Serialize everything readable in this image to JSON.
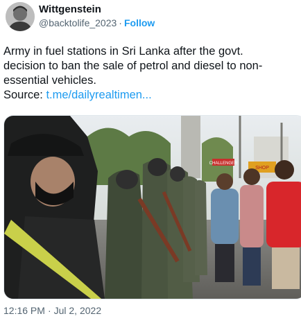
{
  "author": {
    "name": "Wittgenstein",
    "handle": "@backtolife_2023",
    "separator": "·",
    "follow_label": "Follow"
  },
  "tweet": {
    "lines": [
      "Army in fuel stations in Sri Lanka after the govt.",
      "decision to ban the sale of petrol and diesel to non-",
      "essential vehicles."
    ],
    "source_label": "Source: ",
    "source_link": "t.me/dailyrealtimen..."
  },
  "media": {
    "sign_left": "CHALLENGER",
    "sign_right": "SHOP"
  },
  "meta": {
    "time": "12:16 PM",
    "separator": "·",
    "date": "Jul 2, 2022"
  }
}
